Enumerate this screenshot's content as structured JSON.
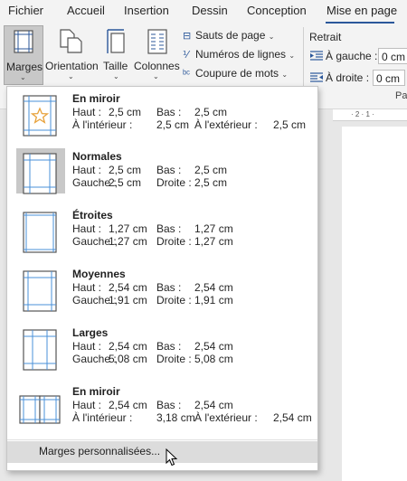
{
  "tabs": [
    "Fichier",
    "Accueil",
    "Insertion",
    "Dessin",
    "Conception",
    "Mise en page"
  ],
  "active_tab": "Mise en page",
  "ribbon": {
    "marges": "Marges",
    "orientation": "Orientation",
    "taille": "Taille",
    "colonnes": "Colonnes",
    "sauts_de_page": "Sauts de page",
    "numeros_de_lignes": "Numéros de lignes",
    "coupure_de_mots": "Coupure de mots",
    "retrait": "Retrait",
    "a_gauche_label": "À gauche :",
    "a_gauche_value": "0 cm",
    "a_droite_label": "À droite :",
    "a_droite_value": "0 cm",
    "group_label_partial": "Pa",
    "ruler_text": "· 2 · 1 ·"
  },
  "margin_options": [
    {
      "title": "En miroir",
      "r1": [
        "Haut :",
        "2,5 cm",
        "Bas :",
        "2,5 cm"
      ],
      "r2": [
        "À l'intérieur :",
        "2,5 cm",
        "À l'extérieur :",
        "2,5 cm"
      ],
      "icon": "mirror-star-margins-icon",
      "selected": false
    },
    {
      "title": "Normales",
      "r1": [
        "Haut :",
        "2,5 cm",
        "Bas :",
        "2,5 cm"
      ],
      "r2": [
        "Gauche :",
        "2,5 cm",
        "Droite :",
        "2,5 cm"
      ],
      "icon": "normal-margins-icon",
      "selected": true
    },
    {
      "title": "Étroites",
      "r1": [
        "Haut :",
        "1,27 cm",
        "Bas :",
        "1,27 cm"
      ],
      "r2": [
        "Gauche :",
        "1,27 cm",
        "Droite :",
        "1,27 cm"
      ],
      "icon": "narrow-margins-icon",
      "selected": false
    },
    {
      "title": "Moyennes",
      "r1": [
        "Haut :",
        "2,54 cm",
        "Bas :",
        "2,54 cm"
      ],
      "r2": [
        "Gauche :",
        "1,91 cm",
        "Droite :",
        "1,91 cm"
      ],
      "icon": "moderate-margins-icon",
      "selected": false
    },
    {
      "title": "Larges",
      "r1": [
        "Haut :",
        "2,54 cm",
        "Bas :",
        "2,54 cm"
      ],
      "r2": [
        "Gauche :",
        "5,08 cm",
        "Droite :",
        "5,08 cm"
      ],
      "icon": "wide-margins-icon",
      "selected": false
    },
    {
      "title": "En miroir",
      "r1": [
        "Haut :",
        "2,54 cm",
        "Bas :",
        "2,54 cm"
      ],
      "r2": [
        "À l'intérieur :",
        "3,18 cm",
        "À l'extérieur :",
        "2,54 cm"
      ],
      "icon": "mirror-margins-icon",
      "selected": false
    }
  ],
  "footer": "Marges personnalisées...",
  "colors": {
    "accent": "#2b579a",
    "star": "#e8a13a",
    "margin_line": "#4a90d9"
  }
}
